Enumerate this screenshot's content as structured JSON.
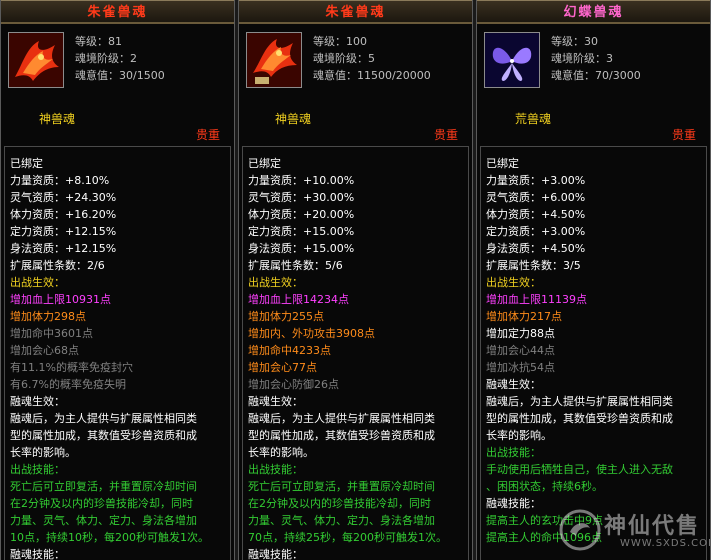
{
  "panels": [
    {
      "title": "朱雀兽魂",
      "level": "等级：81",
      "realm": "魂境阶级：2",
      "soul_value": "魂意值：30/1500",
      "tier": "神兽魂",
      "rarity": "贵重",
      "bound": "已绑定",
      "attrs": [
        "力量资质：+8.10%",
        "灵气资质：+24.30%",
        "体力资质：+16.20%",
        "定力资质：+12.15%",
        "身法资质：+12.15%"
      ],
      "ext_count": "扩展属性条数：2/6",
      "battle_title": "出战生效：",
      "battle_effects": [
        {
          "text": "增加血上限10931点",
          "color": "pk"
        },
        {
          "text": "增加体力298点",
          "color": "or"
        },
        {
          "text": "增加命中3601点",
          "color": "gr"
        },
        {
          "text": "增加会心68点",
          "color": "gr"
        },
        {
          "text": "有11.1%的概率免疫封穴",
          "color": "gr"
        },
        {
          "text": "有6.7%的概率免疫失明",
          "color": "gr"
        }
      ],
      "fuse_title": "融魂生效：",
      "fuse_text": [
        "融魂后，为主人提供与扩展属性相同类",
        "型的属性加成，其数值受珍兽资质和成",
        "长率的影响。"
      ],
      "skill_title": "出战技能：",
      "skill_text": [
        "死亡后可立即复活，并重置原冷却时间",
        "在2分钟及以内的珍兽技能冷却，同时",
        "力量、灵气、体力、定力、身法各增加",
        "10点，持续10秒，每200秒可触发1次。"
      ],
      "fuse_skill_title": "融魂技能："
    },
    {
      "title": "朱雀兽魂",
      "level": "等级：100",
      "realm": "魂境阶级：5",
      "soul_value": "魂意值：11500/20000",
      "tier": "神兽魂",
      "rarity": "贵重",
      "bound": "已绑定",
      "attrs": [
        "力量资质：+10.00%",
        "灵气资质：+30.00%",
        "体力资质：+20.00%",
        "定力资质：+15.00%",
        "身法资质：+15.00%"
      ],
      "ext_count": "扩展属性条数：5/6",
      "battle_title": "出战生效：",
      "battle_effects": [
        {
          "text": "增加血上限14234点",
          "color": "pk"
        },
        {
          "text": "增加体力255点",
          "color": "or"
        },
        {
          "text": "增加内、外功攻击3908点",
          "color": "or"
        },
        {
          "text": "增加命中4233点",
          "color": "or"
        },
        {
          "text": "增加会心77点",
          "color": "or"
        },
        {
          "text": "增加会心防御26点",
          "color": "gr"
        }
      ],
      "fuse_title": "融魂生效：",
      "fuse_text": [
        "融魂后，为主人提供与扩展属性相同类",
        "型的属性加成，其数值受珍兽资质和成",
        "长率的影响。"
      ],
      "skill_title": "出战技能：",
      "skill_text": [
        "死亡后可立即复活，并重置原冷却时间",
        "在2分钟及以内的珍兽技能冷却，同时",
        "力量、灵气、体力、定力、身法各增加",
        "70点，持续25秒，每200秒可触发1次。"
      ],
      "fuse_skill_title": "融魂技能："
    },
    {
      "title": "幻蝶兽魂",
      "level": "等级：30",
      "realm": "魂境阶级：3",
      "soul_value": "魂意值：70/3000",
      "tier": "荒兽魂",
      "rarity": "贵重",
      "bound": "已绑定",
      "attrs": [
        "力量资质：+3.00%",
        "灵气资质：+6.00%",
        "体力资质：+4.50%",
        "定力资质：+3.00%",
        "身法资质：+4.50%"
      ],
      "ext_count": "扩展属性条数：3/5",
      "battle_title": "出战生效：",
      "battle_effects": [
        {
          "text": "增加血上限11139点",
          "color": "pk"
        },
        {
          "text": "增加体力217点",
          "color": "or"
        },
        {
          "text": "增加定力88点",
          "color": "w"
        },
        {
          "text": "增加会心44点",
          "color": "gr"
        },
        {
          "text": "增加冰抗54点",
          "color": "gr"
        }
      ],
      "fuse_title": "融魂生效：",
      "fuse_text": [
        "融魂后，为主人提供与扩展属性相同类",
        "型的属性加成，其数值受珍兽资质和成",
        "长率的影响。"
      ],
      "skill_title": "出战技能：",
      "skill_text": [
        "手动使用后牺牲自己，使主人进入无敌",
        "、困困状态，持续6秒。"
      ],
      "fuse_skill_title": "融魂技能：",
      "fuse_skill_text": [
        "提高主人的玄功击中9点",
        "提高主人的命中1096点"
      ]
    }
  ],
  "watermark": {
    "text": "神仙代售",
    "url": "WWW.SXDS.COM"
  }
}
